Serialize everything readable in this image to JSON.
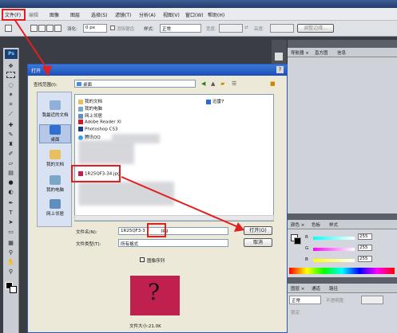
{
  "menu": {
    "file": "文件(F)",
    "items": [
      "图像",
      "图层",
      "选择(S)",
      "滤镜(T)",
      "分析(A)",
      "视图(V)",
      "窗口(W)",
      "帮助(H)"
    ]
  },
  "options": {
    "feather_label": "羽化:",
    "feather_value": "0 px",
    "antialias_label": "消除锯齿",
    "style_label": "样式:",
    "style_value": "正常",
    "width_label": "宽度:",
    "height_label": "高度:",
    "refine_button": "调整边缘..."
  },
  "toolbox": {
    "logo": "Ps"
  },
  "panels": {
    "top_tabs": [
      "导航器 ×",
      "直方图",
      "信息"
    ],
    "color_tabs": [
      "颜色 ×",
      "色板",
      "样式"
    ],
    "color_channels": [
      {
        "label": "R",
        "value": "255"
      },
      {
        "label": "G",
        "value": "255"
      },
      {
        "label": "B",
        "value": "255"
      }
    ],
    "layer_tabs": [
      "图层 ×",
      "通道",
      "路径"
    ],
    "layer_mode": "正常",
    "layer_opacity_label": "不透明度:",
    "lock_label": "锁定:"
  },
  "dialog": {
    "title": "打开",
    "lookin_label": "查找范围(I):",
    "lookin_value": "桌面",
    "places": [
      "我最近的文档",
      "桌面",
      "我的文档",
      "我的电脑",
      "网上邻居"
    ],
    "files": [
      {
        "name": "我的文档",
        "icon": "folder"
      },
      {
        "name": "我的电脑",
        "icon": "computer"
      },
      {
        "name": "网上邻居",
        "icon": "network"
      },
      {
        "name": "Adobe Reader XI",
        "icon": "pdf"
      },
      {
        "name": "Photoshop CS3",
        "icon": "ps"
      },
      {
        "name": "腾讯QQ",
        "icon": "qq"
      },
      {
        "name": "1R25QF3-34.jpg",
        "icon": "image"
      }
    ],
    "files_col2": [
      {
        "name": "迅雷7",
        "icon": "thunder"
      }
    ],
    "filename_label": "文件名(N):",
    "filename_value": "1R25QF3-3",
    "filename_ext": "jpg",
    "filetype_label": "文件类型(T):",
    "filetype_value": "所有格式",
    "open_button": "打开(O)",
    "cancel_button": "取消",
    "sequence_label": "图像序列",
    "filesize_label": "文件大小:21.0K"
  },
  "colors": {
    "accent_red": "#e02020",
    "dialog_title": "#1b4fb5",
    "preview_bg": "#c0204d"
  }
}
